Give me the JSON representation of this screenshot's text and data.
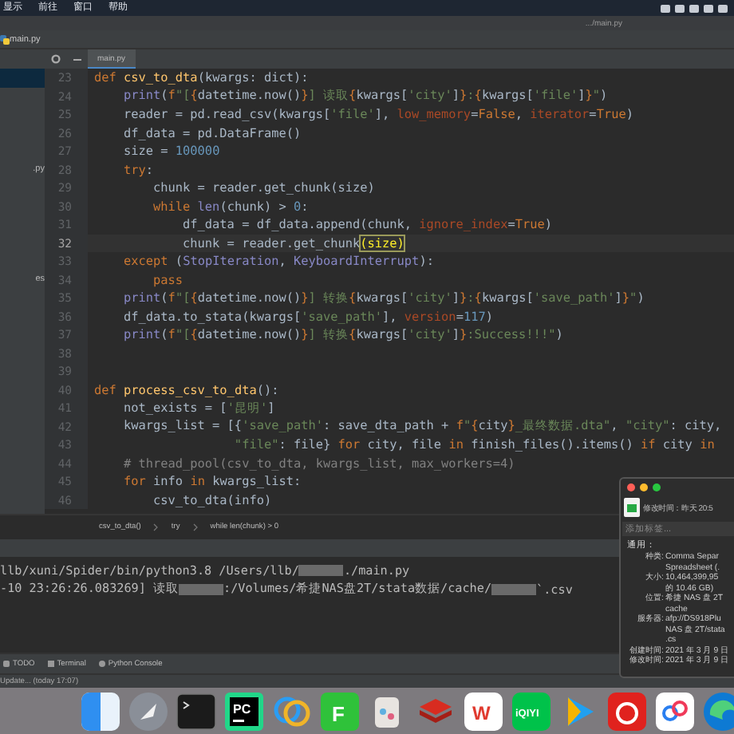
{
  "menu_bar": {
    "items": [
      "显示",
      "前往",
      "窗口",
      "帮助"
    ]
  },
  "title_bar": {
    "path": ".../main.py"
  },
  "project_tab": {
    "label": "main.py"
  },
  "sidebar": {
    "items": [
      {
        "selected": true
      },
      {
        "label": ".py",
        "selected": false
      },
      {
        "label": "es",
        "selected": false
      }
    ]
  },
  "editor_tabs": [
    {
      "label": "main.py",
      "selected": true
    }
  ],
  "code_lines": [
    {
      "number": "23",
      "current": false,
      "tokens": [
        {
          "text": "def ",
          "kind": "kw"
        },
        {
          "text": "csv_to_dta",
          "kind": "fn"
        },
        {
          "text": "(kwargs: dict):",
          "kind": "p"
        }
      ]
    },
    {
      "number": "24",
      "current": false,
      "tokens": [
        {
          "text": "    print",
          "kind": "bi"
        },
        {
          "text": "(",
          "kind": "p"
        },
        {
          "text": "f",
          "kind": "kw"
        },
        {
          "text": "\"[",
          "kind": "str"
        },
        {
          "text": "{",
          "kind": "kw"
        },
        {
          "text": "datetime.now()",
          "kind": "p"
        },
        {
          "text": "}",
          "kind": "kw"
        },
        {
          "text": "] 读取",
          "kind": "str"
        },
        {
          "text": "{",
          "kind": "kw"
        },
        {
          "text": "kwargs[",
          "kind": "p"
        },
        {
          "text": "'city'",
          "kind": "str"
        },
        {
          "text": "]",
          "kind": "p"
        },
        {
          "text": "}",
          "kind": "kw"
        },
        {
          "text": ":",
          "kind": "str"
        },
        {
          "text": "{",
          "kind": "kw"
        },
        {
          "text": "kwargs[",
          "kind": "p"
        },
        {
          "text": "'file'",
          "kind": "str"
        },
        {
          "text": "]",
          "kind": "p"
        },
        {
          "text": "}",
          "kind": "kw"
        },
        {
          "text": "\"",
          "kind": "str"
        },
        {
          "text": ")",
          "kind": "p"
        }
      ]
    },
    {
      "number": "25",
      "current": false,
      "tokens": [
        {
          "text": "    reader = pd.read_csv(kwargs[",
          "kind": "p"
        },
        {
          "text": "'file'",
          "kind": "str"
        },
        {
          "text": "], ",
          "kind": "p"
        },
        {
          "text": "low_memory",
          "kind": "arg"
        },
        {
          "text": "=",
          "kind": "p"
        },
        {
          "text": "False",
          "kind": "kw"
        },
        {
          "text": ", ",
          "kind": "p"
        },
        {
          "text": "iterator",
          "kind": "arg"
        },
        {
          "text": "=",
          "kind": "p"
        },
        {
          "text": "True",
          "kind": "kw"
        },
        {
          "text": ")",
          "kind": "p"
        }
      ]
    },
    {
      "number": "26",
      "current": false,
      "tokens": [
        {
          "text": "    df_data = pd.DataFrame()",
          "kind": "p"
        }
      ]
    },
    {
      "number": "27",
      "current": false,
      "tokens": [
        {
          "text": "    size = ",
          "kind": "p"
        },
        {
          "text": "100000",
          "kind": "num"
        }
      ]
    },
    {
      "number": "28",
      "current": false,
      "tokens": [
        {
          "text": "    try",
          "kind": "kw"
        },
        {
          "text": ":",
          "kind": "p"
        }
      ]
    },
    {
      "number": "29",
      "current": false,
      "tokens": [
        {
          "text": "        chunk = reader.get_chunk(size)",
          "kind": "p"
        }
      ]
    },
    {
      "number": "30",
      "current": false,
      "tokens": [
        {
          "text": "        while ",
          "kind": "kw"
        },
        {
          "text": "len",
          "kind": "bi"
        },
        {
          "text": "(chunk) > ",
          "kind": "p"
        },
        {
          "text": "0",
          "kind": "num"
        },
        {
          "text": ":",
          "kind": "p"
        }
      ]
    },
    {
      "number": "31",
      "current": false,
      "tokens": [
        {
          "text": "            df_data = df_data.append(chunk, ",
          "kind": "p"
        },
        {
          "text": "ignore_index",
          "kind": "arg"
        },
        {
          "text": "=",
          "kind": "p"
        },
        {
          "text": "True",
          "kind": "kw"
        },
        {
          "text": ")",
          "kind": "p"
        }
      ]
    },
    {
      "number": "32",
      "current": true,
      "tokens": [
        {
          "text": "            chunk = reader.get_chunk",
          "kind": "p"
        },
        {
          "text": "(size)",
          "kind": "match"
        }
      ]
    },
    {
      "number": "33",
      "current": false,
      "tokens": [
        {
          "text": "    except ",
          "kind": "kw"
        },
        {
          "text": "(",
          "kind": "p"
        },
        {
          "text": "StopIteration",
          "kind": "bi"
        },
        {
          "text": ", ",
          "kind": "p"
        },
        {
          "text": "KeyboardInterrupt",
          "kind": "bi"
        },
        {
          "text": "):",
          "kind": "p"
        }
      ]
    },
    {
      "number": "34",
      "current": false,
      "tokens": [
        {
          "text": "        pass",
          "kind": "kw"
        }
      ]
    },
    {
      "number": "35",
      "current": false,
      "tokens": [
        {
          "text": "    print",
          "kind": "bi"
        },
        {
          "text": "(",
          "kind": "p"
        },
        {
          "text": "f",
          "kind": "kw"
        },
        {
          "text": "\"[",
          "kind": "str"
        },
        {
          "text": "{",
          "kind": "kw"
        },
        {
          "text": "datetime.now()",
          "kind": "p"
        },
        {
          "text": "}",
          "kind": "kw"
        },
        {
          "text": "] 转换",
          "kind": "str"
        },
        {
          "text": "{",
          "kind": "kw"
        },
        {
          "text": "kwargs[",
          "kind": "p"
        },
        {
          "text": "'city'",
          "kind": "str"
        },
        {
          "text": "]",
          "kind": "p"
        },
        {
          "text": "}",
          "kind": "kw"
        },
        {
          "text": ":",
          "kind": "str"
        },
        {
          "text": "{",
          "kind": "kw"
        },
        {
          "text": "kwargs[",
          "kind": "p"
        },
        {
          "text": "'save_path'",
          "kind": "str"
        },
        {
          "text": "]",
          "kind": "p"
        },
        {
          "text": "}",
          "kind": "kw"
        },
        {
          "text": "\"",
          "kind": "str"
        },
        {
          "text": ")",
          "kind": "p"
        }
      ]
    },
    {
      "number": "36",
      "current": false,
      "tokens": [
        {
          "text": "    df_data.to_stata(kwargs[",
          "kind": "p"
        },
        {
          "text": "'save_path'",
          "kind": "str"
        },
        {
          "text": "], ",
          "kind": "p"
        },
        {
          "text": "version",
          "kind": "arg"
        },
        {
          "text": "=",
          "kind": "p"
        },
        {
          "text": "117",
          "kind": "num"
        },
        {
          "text": ")",
          "kind": "p"
        }
      ]
    },
    {
      "number": "37",
      "current": false,
      "tokens": [
        {
          "text": "    print",
          "kind": "bi"
        },
        {
          "text": "(",
          "kind": "p"
        },
        {
          "text": "f",
          "kind": "kw"
        },
        {
          "text": "\"[",
          "kind": "str"
        },
        {
          "text": "{",
          "kind": "kw"
        },
        {
          "text": "datetime.now()",
          "kind": "p"
        },
        {
          "text": "}",
          "kind": "kw"
        },
        {
          "text": "] 转换",
          "kind": "str"
        },
        {
          "text": "{",
          "kind": "kw"
        },
        {
          "text": "kwargs[",
          "kind": "p"
        },
        {
          "text": "'city'",
          "kind": "str"
        },
        {
          "text": "]",
          "kind": "p"
        },
        {
          "text": "}",
          "kind": "kw"
        },
        {
          "text": ":Success!!!\"",
          "kind": "str"
        },
        {
          "text": ")",
          "kind": "p"
        }
      ]
    },
    {
      "number": "38",
      "current": false
    },
    {
      "number": "39",
      "current": false
    },
    {
      "number": "40",
      "current": false,
      "tokens": [
        {
          "text": "def ",
          "kind": "kw"
        },
        {
          "text": "process_csv_to_dta",
          "kind": "fn"
        },
        {
          "text": "():",
          "kind": "p"
        }
      ]
    },
    {
      "number": "41",
      "current": false,
      "tokens": [
        {
          "text": "    not_exists = [",
          "kind": "p"
        },
        {
          "text": "'昆明'",
          "kind": "str"
        },
        {
          "text": "]",
          "kind": "p"
        }
      ]
    },
    {
      "number": "42",
      "current": false,
      "tokens": [
        {
          "text": "    kwargs_list = [{",
          "kind": "p"
        },
        {
          "text": "'save_path'",
          "kind": "str"
        },
        {
          "text": ": save_dta_path + ",
          "kind": "p"
        },
        {
          "text": "f",
          "kind": "kw"
        },
        {
          "text": "\"",
          "kind": "str"
        },
        {
          "text": "{",
          "kind": "kw"
        },
        {
          "text": "city",
          "kind": "p"
        },
        {
          "text": "}",
          "kind": "kw"
        },
        {
          "text": "_最终数据.dta\"",
          "kind": "str"
        },
        {
          "text": ", ",
          "kind": "p"
        },
        {
          "text": "\"city\"",
          "kind": "str"
        },
        {
          "text": ": city,",
          "kind": "p"
        }
      ]
    },
    {
      "number": "43",
      "current": false,
      "tokens": [
        {
          "text": "                   \"file\"",
          "kind": "str"
        },
        {
          "text": ": file} ",
          "kind": "p"
        },
        {
          "text": "for ",
          "kind": "kw"
        },
        {
          "text": "city, file ",
          "kind": "p"
        },
        {
          "text": "in ",
          "kind": "kw"
        },
        {
          "text": "finish_files().items() ",
          "kind": "p"
        },
        {
          "text": "if ",
          "kind": "kw"
        },
        {
          "text": "city ",
          "kind": "p"
        },
        {
          "text": "in",
          "kind": "kw"
        }
      ]
    },
    {
      "number": "44",
      "current": false,
      "tokens": [
        {
          "text": "    # thread_pool(csv_to_dta, kwargs_list, max_workers=4)",
          "kind": "cm"
        }
      ]
    },
    {
      "number": "45",
      "current": false,
      "tokens": [
        {
          "text": "    for ",
          "kind": "kw"
        },
        {
          "text": "info ",
          "kind": "p"
        },
        {
          "text": "in ",
          "kind": "kw"
        },
        {
          "text": "kwargs_list:",
          "kind": "p"
        }
      ]
    },
    {
      "number": "46",
      "current": false,
      "tokens": [
        {
          "text": "        csv_to_dta(info)",
          "kind": "p"
        }
      ]
    }
  ],
  "breadcrumbs": [
    "csv_to_dta()",
    "try",
    "while len(chunk) > 0"
  ],
  "console_lines": [
    {
      "parts": [
        {
          "kind": "text",
          "text": "llb/xuni/Spider/bin/python3.8 /Users/llb/"
        },
        {
          "kind": "redacted"
        },
        {
          "kind": "text",
          "text": "./main.py"
        }
      ]
    },
    {
      "parts": [
        {
          "kind": "text",
          "text": "-10 23:26:26.083269] 读取"
        },
        {
          "kind": "redacted"
        },
        {
          "kind": "text",
          "text": ":/Volumes/希捷NAS盘2T/stata数据/cache/"
        },
        {
          "kind": "redacted"
        },
        {
          "kind": "text",
          "text": "`.csv"
        }
      ]
    }
  ],
  "tool_tabs": [
    {
      "label": "TODO",
      "kind": "list"
    },
    {
      "label": "Terminal",
      "kind": "terminal"
    },
    {
      "label": "Python Console",
      "kind": "console"
    }
  ],
  "status_bar": {
    "text": "Update... (today 17:07)"
  },
  "info_window": {
    "modified_line": "修改时间：昨天 20:5",
    "tags_placeholder": "添加标签...",
    "section": "通用：",
    "rows": [
      {
        "label": "种类:",
        "lines": [
          "Comma Separ",
          "Spreadsheet (."
        ]
      },
      {
        "label": "大小:",
        "lines": [
          "10,464,399,95",
          "的 10.46 GB)"
        ]
      },
      {
        "label": "位置:",
        "lines": [
          "希捷 NAS 盘 2T",
          "cache"
        ]
      },
      {
        "label": "服务器:",
        "lines": [
          "afp://DS918Plu",
          "NAS 盘 2T/stata",
          ".cs"
        ]
      },
      {
        "label": "创建时间:",
        "lines": [
          "2021 年 3 月 9 日"
        ]
      },
      {
        "label": "修改时间:",
        "lines": [
          "2021 年 3 月 9 日"
        ]
      }
    ]
  },
  "dock": [
    {
      "kind": "finder"
    },
    {
      "kind": "rocket"
    },
    {
      "kind": "terminal"
    },
    {
      "kind": "pycharm",
      "label": "PC"
    },
    {
      "kind": "rings"
    },
    {
      "kind": "green",
      "label": "F"
    },
    {
      "kind": "cup"
    },
    {
      "kind": "stack"
    },
    {
      "kind": "wps",
      "label": "W"
    },
    {
      "kind": "iqiyi",
      "label": "iQIYI"
    },
    {
      "kind": "play"
    },
    {
      "kind": "music"
    },
    {
      "kind": "cloud"
    },
    {
      "kind": "wave"
    }
  ]
}
